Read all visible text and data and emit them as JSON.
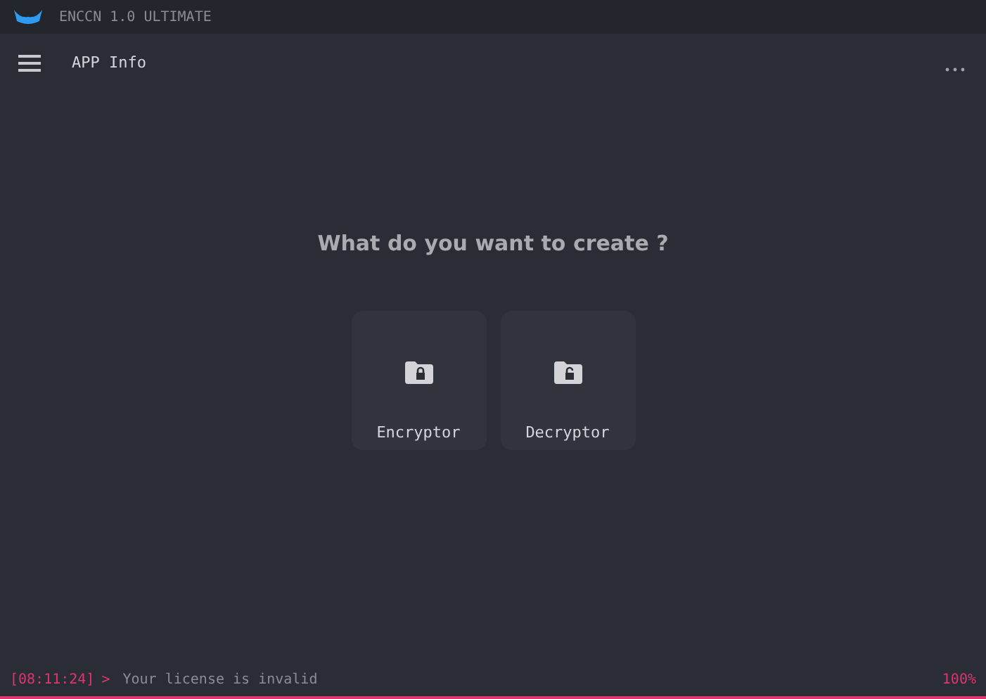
{
  "window": {
    "title": "ENCCN 1.0 ULTIMATE"
  },
  "toolbar": {
    "title": "APP Info"
  },
  "prompt": "What do you want to create ?",
  "options": [
    {
      "label": "Encryptor",
      "kind": "locked"
    },
    {
      "label": "Decryptor",
      "kind": "unlocked"
    }
  ],
  "status_bar": {
    "time": "[08:11:24]",
    "arrow": ">",
    "message": "Your license is invalid",
    "percent": "100%"
  }
}
